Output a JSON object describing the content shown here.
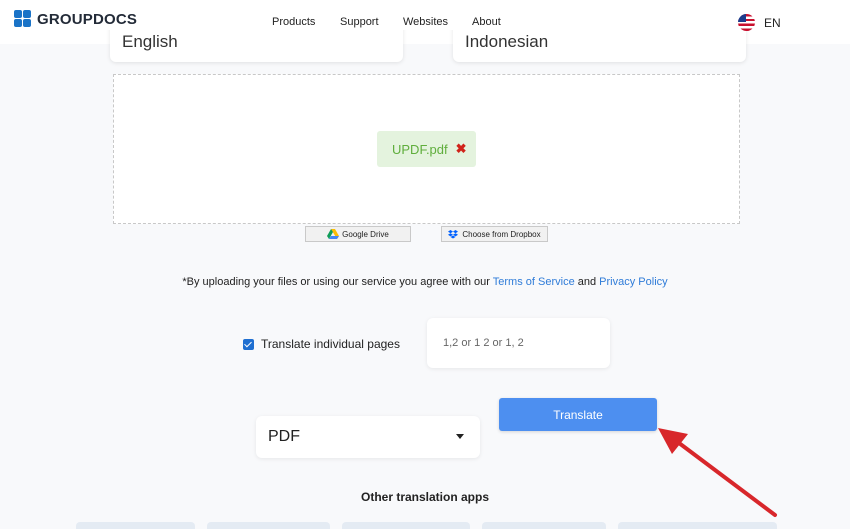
{
  "header": {
    "brand": "GROUPDOCS",
    "nav": [
      "Products",
      "Support",
      "Websites",
      "About"
    ],
    "language": "EN",
    "flag_icon": "us-flag-icon"
  },
  "language_selectors": {
    "source": "English",
    "target": "Indonesian"
  },
  "upload": {
    "file_name": "UPDF.pdf",
    "remove_icon": "close-icon",
    "google_drive_label": "Google Drive",
    "dropbox_label": "Choose from Dropbox"
  },
  "terms": {
    "prefix": "*By uploading your files or using our service you agree with our ",
    "tos": "Terms of Service",
    "conj": " and ",
    "privacy": "Privacy Policy"
  },
  "options": {
    "translate_pages_label": "Translate individual pages",
    "translate_pages_checked": true,
    "pages_placeholder": "1,2 or 1 2 or 1, 2",
    "output_format": "PDF"
  },
  "actions": {
    "translate_label": "Translate"
  },
  "other_apps": {
    "title": "Other translation apps"
  },
  "colors": {
    "accent": "#4d8ff0",
    "link": "#2f7cd8",
    "file_chip_bg": "#e4f3de",
    "file_name": "#5fae3c",
    "remove": "#d0231a",
    "annotation_arrow": "#d8272b"
  }
}
